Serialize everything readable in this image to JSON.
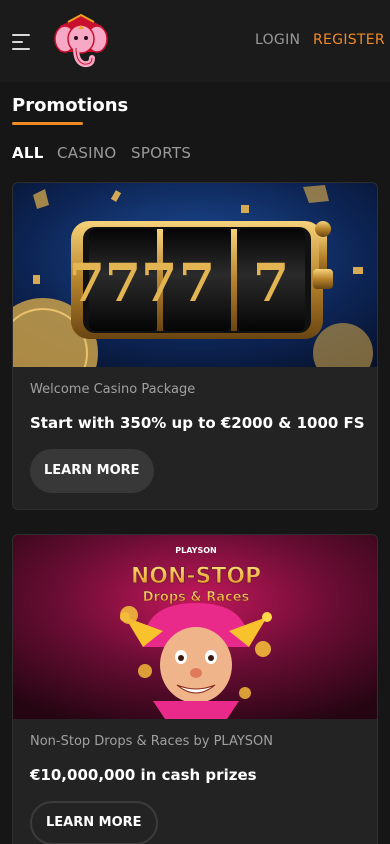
{
  "header": {
    "menu_icon": "hamburger-icon",
    "logo_icon": "elephant-logo",
    "login_label": "LOGIN",
    "register_label": "REGISTER",
    "accent": "#f08a24"
  },
  "page": {
    "title": "Promotions",
    "tabs": [
      {
        "label": "ALL",
        "active": true
      },
      {
        "label": "CASINO",
        "active": false
      },
      {
        "label": "SPORTS",
        "active": false
      }
    ]
  },
  "promotions": [
    {
      "image_label": "777",
      "subtitle": "Welcome Casino Package",
      "headline": "Start with 350% up to €2000 & 1000 FS",
      "button_label": "LEARN MORE"
    },
    {
      "image_brand": "PLAYSON",
      "image_title_line1": "NON-STOP",
      "image_title_line2": "Drops & Races",
      "subtitle": "Non-Stop Drops & Races by PLAYSON",
      "headline": "€10,000,000 in cash prizes",
      "button_label": "LEARN MORE"
    }
  ]
}
